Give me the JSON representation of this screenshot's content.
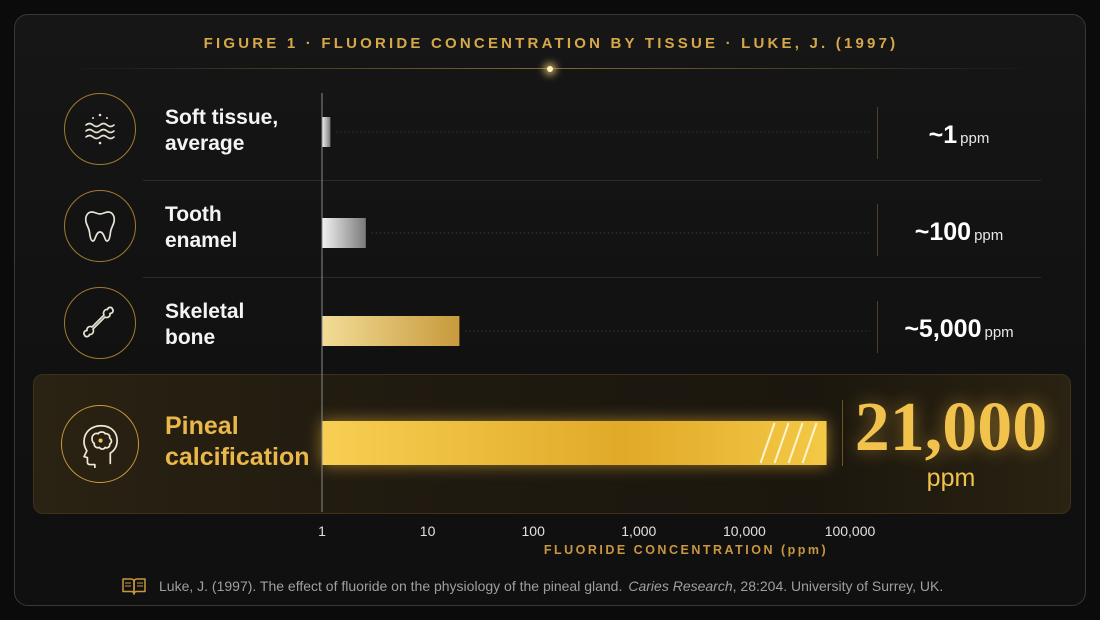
{
  "title": "FIGURE 1 · FLUORIDE CONCENTRATION BY TISSUE · LUKE, J. (1997)",
  "colors": {
    "gold": "#d6a84a",
    "gold_bright": "#f1c24c",
    "background": "#111111",
    "gray_bar": "#b9b9b9"
  },
  "rows": [
    {
      "label_line1": "Soft tissue,",
      "label_line2": "average",
      "icon": "water-waves-icon",
      "value_text": "~1",
      "unit": "ppm"
    },
    {
      "label_line1": "Tooth",
      "label_line2": "enamel",
      "icon": "tooth-icon",
      "value_text": "~100",
      "unit": "ppm"
    },
    {
      "label_line1": "Skeletal",
      "label_line2": "bone",
      "icon": "bone-icon",
      "value_text": "~5,000",
      "unit": "ppm"
    },
    {
      "label_line1": "Pineal",
      "label_line2": "calcification",
      "icon": "brain-head-icon",
      "value_text": "21,000",
      "unit": "ppm"
    }
  ],
  "chart_data": {
    "type": "bar",
    "orientation": "horizontal",
    "title": "FIGURE 1 · FLUORIDE CONCENTRATION BY TISSUE · LUKE, J. (1997)",
    "xlabel": "FLUORIDE CONCENTRATION (ppm)",
    "x_scale": "log",
    "xlim": [
      1,
      100000
    ],
    "x_ticks": [
      "1",
      "10",
      "100",
      "1,000",
      "10,000",
      "100,000"
    ],
    "categories": [
      "Soft tissue, average",
      "Tooth enamel",
      "Skeletal bone",
      "Pineal calcification"
    ],
    "values": [
      1.2,
      2.6,
      20,
      60000
    ],
    "value_labels": [
      "~1 ppm",
      "~100 ppm",
      "~5,000 ppm",
      "21,000 ppm"
    ],
    "axis_break_on_last_bar": true,
    "highlighted_category": "Pineal calcification"
  },
  "source": {
    "text": "Luke, J. (1997). The effect of fluoride on the physiology of the pineal gland.",
    "journal": "Caries Research",
    "rest": ", 28:204. University of Surrey, UK."
  }
}
